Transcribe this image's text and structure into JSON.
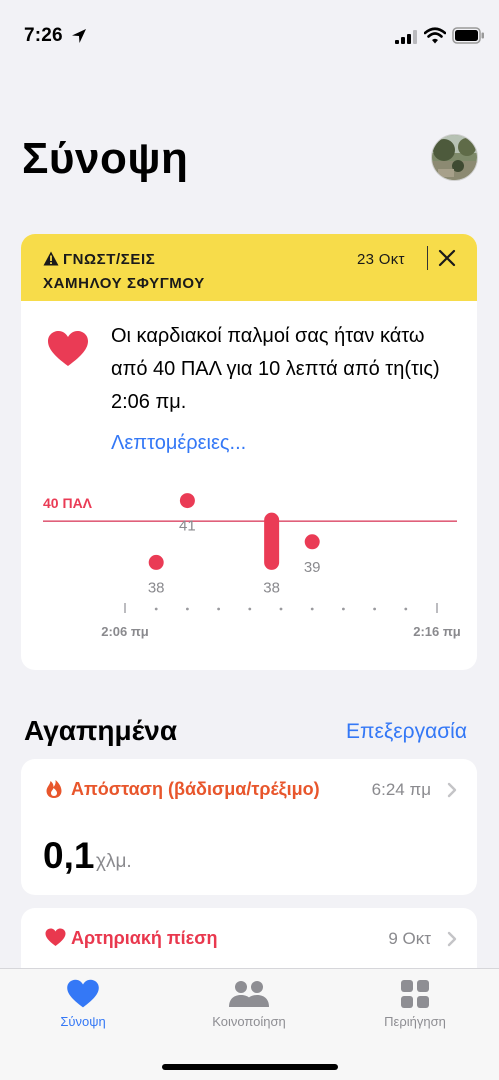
{
  "status_bar": {
    "time": "7:26"
  },
  "header": {
    "title": "Σύνοψη"
  },
  "alert": {
    "title_line1": "ΓΝΩΣΤ/ΣΕΙΣ",
    "title_line2": "ΧΑΜΗΛΟΥ ΣΦΥΓΜΟΥ",
    "date": "23 Οκτ",
    "message": "Οι καρδιακοί παλμοί σας ήταν κάτω από 40 ΠΑΛ για 10 λεπτά από τη(τις) 2:06 πμ.",
    "details_link": "Λεπτομέρειες..."
  },
  "chart_data": {
    "type": "scatter",
    "threshold": {
      "label": "40 ΠΑΛ",
      "value": 40
    },
    "x_start_label": "2:06 πμ",
    "x_end_label": "2:16 πμ",
    "x_unit_minutes": [
      0,
      10
    ],
    "ylim": [
      37,
      42
    ],
    "points": [
      {
        "x": 1,
        "y": 38,
        "label": "38",
        "kind": "dot"
      },
      {
        "x": 2,
        "y": 41,
        "label": "41",
        "kind": "dot"
      },
      {
        "x": 4.7,
        "y_low": 38,
        "y_high": 40.05,
        "label": "38",
        "kind": "range"
      },
      {
        "x": 6,
        "y": 39,
        "label": "39",
        "kind": "dot"
      }
    ],
    "colors": {
      "marks": "#ea3b55",
      "threshold": "#e0607a"
    }
  },
  "favorites": {
    "title": "Αγαπημένα",
    "edit_label": "Επεξεργασία",
    "items": [
      {
        "title": "Απόσταση (βάδισμα/τρέξιμο)",
        "time": "6:24 πμ",
        "value": "0,1",
        "unit": "χλμ.",
        "color": "#e8562c",
        "icon": "flame-icon"
      },
      {
        "title": "Αρτηριακή πίεση",
        "time": "9 Οκτ",
        "color": "#e9384e",
        "icon": "heart-icon"
      }
    ]
  },
  "tabs": [
    {
      "label": "Σύνοψη",
      "icon": "heart-icon",
      "active": true
    },
    {
      "label": "Κοινοποίηση",
      "icon": "people-icon",
      "active": false
    },
    {
      "label": "Περιήγηση",
      "icon": "grid-icon",
      "active": false
    }
  ],
  "colors": {
    "accent": "#3478f6",
    "alert_bg": "#f7dc4a",
    "heart": "#ea3b55"
  }
}
